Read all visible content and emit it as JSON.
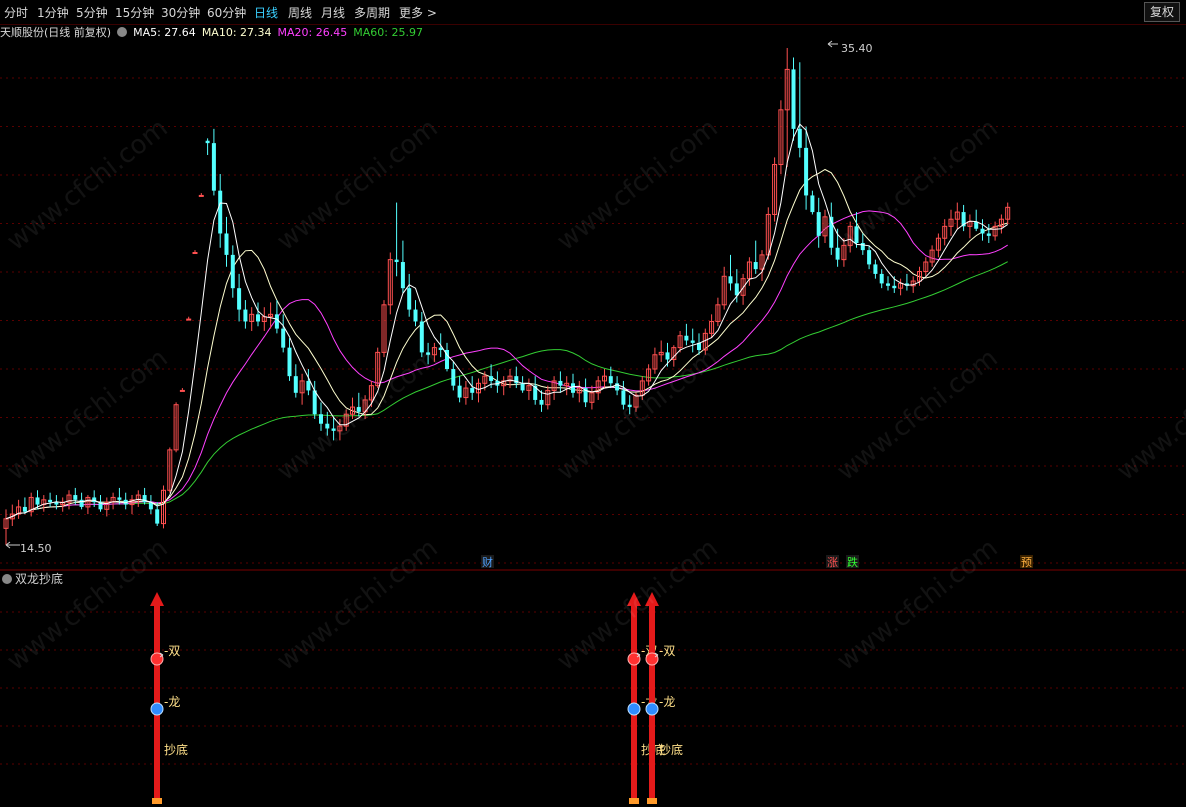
{
  "toolbar": {
    "tabs": [
      "分时",
      "1分钟",
      "5分钟",
      "15分钟",
      "30分钟",
      "60分钟",
      "日线",
      "周线",
      "月线",
      "多周期",
      "更多 >"
    ],
    "active_tab": "日线",
    "right_button": "复权"
  },
  "legend": {
    "stock": "天顺股份(日线 前复权)",
    "ma5": "MA5: 27.64",
    "ma10": "MA10: 27.34",
    "ma20": "MA20: 26.45",
    "ma60": "MA60: 25.97"
  },
  "colors": {
    "up": "#ff5050",
    "down": "#54ffff",
    "ma5": "#ffffff",
    "ma10": "#ffffd0",
    "ma20": "#ff40ff",
    "ma60": "#33cc33",
    "grid": "#5a0000",
    "signal": "#e41a1a"
  },
  "price_marks": {
    "high": "35.40",
    "low": "14.50"
  },
  "event_badges": [
    {
      "text": "财",
      "color": "#4fa0ff"
    },
    {
      "text": "涨",
      "color": "#ff5050"
    },
    {
      "text": "跌",
      "color": "#33ff33"
    },
    {
      "text": "预",
      "color": "#ffb040"
    }
  ],
  "indicator": {
    "title": "双龙抄底",
    "labels": {
      "shuang": "-双",
      "long": "-龙",
      "chaodi": "抄底"
    }
  },
  "watermark": "www.cfchi.com",
  "chart_data": {
    "type": "candlestick",
    "y_range": [
      14.5,
      35.4
    ],
    "signals_at_candle_index": [
      24,
      99,
      102
    ],
    "candles": [
      [
        15.2,
        16.0,
        14.5,
        15.6
      ],
      [
        15.6,
        16.2,
        15.3,
        15.8
      ],
      [
        15.8,
        16.4,
        15.6,
        16.1
      ],
      [
        16.1,
        16.5,
        15.8,
        15.9
      ],
      [
        15.9,
        16.7,
        15.7,
        16.5
      ],
      [
        16.5,
        16.8,
        16.0,
        16.2
      ],
      [
        16.2,
        16.6,
        15.9,
        16.4
      ],
      [
        16.4,
        16.7,
        16.1,
        16.3
      ],
      [
        16.3,
        16.6,
        16.0,
        16.2
      ],
      [
        16.2,
        16.5,
        15.9,
        16.3
      ],
      [
        16.3,
        16.8,
        16.0,
        16.6
      ],
      [
        16.6,
        16.9,
        16.2,
        16.4
      ],
      [
        16.4,
        16.7,
        16.0,
        16.1
      ],
      [
        16.1,
        16.6,
        15.8,
        16.5
      ],
      [
        16.5,
        16.8,
        16.1,
        16.3
      ],
      [
        16.3,
        16.6,
        15.9,
        16.0
      ],
      [
        16.0,
        16.5,
        15.7,
        16.3
      ],
      [
        16.3,
        16.7,
        16.0,
        16.5
      ],
      [
        16.5,
        16.9,
        16.2,
        16.4
      ],
      [
        16.4,
        16.7,
        16.0,
        16.2
      ],
      [
        16.2,
        16.6,
        15.8,
        16.4
      ],
      [
        16.4,
        16.8,
        16.1,
        16.6
      ],
      [
        16.6,
        16.9,
        16.2,
        16.3
      ],
      [
        16.3,
        16.6,
        15.8,
        16.0
      ],
      [
        16.0,
        16.3,
        15.3,
        15.4
      ],
      [
        15.4,
        17.0,
        15.2,
        16.8
      ],
      [
        16.8,
        18.6,
        16.7,
        18.5
      ],
      [
        18.5,
        20.5,
        18.4,
        20.4
      ],
      [
        21.0,
        21.1,
        21.0,
        21.0
      ],
      [
        24.0,
        24.1,
        24.0,
        24.0
      ],
      [
        26.8,
        26.9,
        26.8,
        26.8
      ],
      [
        29.2,
        29.3,
        29.2,
        29.2
      ],
      [
        31.5,
        31.6,
        30.9,
        31.4
      ],
      [
        31.4,
        32.0,
        29.2,
        29.4
      ],
      [
        29.4,
        30.1,
        27.0,
        27.6
      ],
      [
        27.6,
        28.3,
        26.2,
        26.7
      ],
      [
        26.7,
        27.1,
        24.9,
        25.3
      ],
      [
        25.3,
        25.9,
        23.9,
        24.4
      ],
      [
        24.4,
        24.8,
        23.6,
        23.9
      ],
      [
        23.9,
        24.5,
        23.5,
        24.2
      ],
      [
        24.2,
        24.7,
        23.7,
        23.9
      ],
      [
        23.9,
        24.5,
        23.5,
        24.1
      ],
      [
        24.1,
        24.7,
        23.6,
        24.2
      ],
      [
        24.2,
        24.8,
        23.4,
        23.6
      ],
      [
        23.6,
        24.2,
        22.6,
        22.8
      ],
      [
        22.8,
        23.2,
        21.4,
        21.6
      ],
      [
        21.6,
        22.1,
        20.7,
        20.9
      ],
      [
        20.9,
        21.7,
        20.4,
        21.4
      ],
      [
        21.4,
        21.9,
        20.8,
        21.0
      ],
      [
        21.0,
        21.4,
        19.8,
        20.0
      ],
      [
        20.0,
        20.5,
        19.3,
        19.6
      ],
      [
        19.6,
        20.1,
        19.1,
        19.4
      ],
      [
        19.4,
        19.9,
        18.9,
        19.3
      ],
      [
        19.3,
        19.8,
        18.9,
        19.5
      ],
      [
        19.5,
        20.2,
        19.3,
        20.0
      ],
      [
        20.0,
        20.7,
        19.8,
        20.3
      ],
      [
        20.3,
        20.9,
        19.9,
        20.1
      ],
      [
        20.1,
        20.8,
        19.8,
        20.6
      ],
      [
        20.6,
        21.4,
        20.3,
        21.2
      ],
      [
        21.2,
        22.8,
        21.1,
        22.6
      ],
      [
        22.6,
        24.8,
        22.4,
        24.6
      ],
      [
        24.6,
        26.8,
        24.2,
        26.5
      ],
      [
        26.5,
        28.9,
        25.8,
        26.4
      ],
      [
        26.4,
        27.3,
        25.1,
        25.3
      ],
      [
        25.3,
        25.9,
        24.1,
        24.4
      ],
      [
        24.4,
        24.8,
        23.7,
        23.9
      ],
      [
        23.9,
        24.3,
        22.4,
        22.6
      ],
      [
        22.6,
        23.0,
        22.1,
        22.5
      ],
      [
        22.5,
        23.0,
        22.2,
        22.8
      ],
      [
        22.8,
        23.4,
        22.4,
        22.7
      ],
      [
        22.7,
        23.0,
        21.8,
        21.9
      ],
      [
        21.9,
        22.2,
        21.0,
        21.2
      ],
      [
        21.2,
        21.6,
        20.5,
        20.7
      ],
      [
        20.7,
        21.4,
        20.4,
        21.1
      ],
      [
        21.1,
        21.6,
        20.6,
        20.9
      ],
      [
        20.9,
        21.5,
        20.5,
        21.3
      ],
      [
        21.3,
        21.8,
        21.0,
        21.6
      ],
      [
        21.6,
        22.1,
        21.1,
        21.4
      ],
      [
        21.4,
        21.8,
        20.9,
        21.2
      ],
      [
        21.2,
        21.6,
        20.8,
        21.4
      ],
      [
        21.4,
        21.9,
        21.1,
        21.6
      ],
      [
        21.6,
        22.0,
        21.1,
        21.3
      ],
      [
        21.3,
        21.6,
        20.9,
        21.0
      ],
      [
        21.0,
        21.5,
        20.6,
        21.2
      ],
      [
        21.2,
        21.6,
        20.4,
        20.6
      ],
      [
        20.6,
        21.0,
        20.1,
        20.4
      ],
      [
        20.4,
        21.2,
        20.2,
        21.0
      ],
      [
        21.0,
        21.6,
        20.6,
        21.4
      ],
      [
        21.4,
        21.8,
        20.9,
        21.2
      ],
      [
        21.2,
        21.6,
        20.8,
        21.3
      ],
      [
        21.3,
        21.7,
        20.7,
        20.9
      ],
      [
        20.9,
        21.4,
        20.5,
        21.1
      ],
      [
        21.1,
        21.5,
        20.3,
        20.5
      ],
      [
        20.5,
        21.2,
        20.2,
        20.9
      ],
      [
        20.9,
        21.6,
        20.6,
        21.4
      ],
      [
        21.4,
        21.9,
        21.1,
        21.6
      ],
      [
        21.6,
        22.0,
        21.1,
        21.3
      ],
      [
        21.3,
        21.6,
        20.8,
        21.0
      ],
      [
        21.0,
        21.4,
        20.2,
        20.4
      ],
      [
        20.4,
        20.8,
        20.0,
        20.3
      ],
      [
        20.3,
        20.9,
        20.1,
        20.8
      ],
      [
        20.8,
        21.6,
        20.6,
        21.4
      ],
      [
        21.4,
        22.1,
        21.2,
        21.9
      ],
      [
        21.9,
        22.8,
        21.7,
        22.5
      ],
      [
        22.5,
        23.1,
        22.2,
        22.6
      ],
      [
        22.6,
        23.0,
        22.0,
        22.3
      ],
      [
        22.3,
        22.9,
        22.0,
        22.8
      ],
      [
        22.8,
        23.5,
        22.6,
        23.3
      ],
      [
        23.3,
        23.8,
        22.9,
        23.1
      ],
      [
        23.1,
        23.6,
        22.6,
        23.0
      ],
      [
        23.0,
        23.4,
        22.5,
        22.7
      ],
      [
        22.7,
        23.6,
        22.5,
        23.4
      ],
      [
        23.4,
        24.2,
        23.2,
        23.9
      ],
      [
        23.9,
        24.9,
        23.7,
        24.6
      ],
      [
        24.6,
        26.2,
        24.4,
        25.8
      ],
      [
        25.8,
        26.7,
        25.2,
        25.5
      ],
      [
        25.5,
        26.1,
        24.7,
        25.0
      ],
      [
        25.0,
        25.9,
        24.6,
        25.7
      ],
      [
        25.7,
        26.6,
        25.4,
        26.4
      ],
      [
        26.4,
        27.3,
        25.9,
        26.1
      ],
      [
        26.1,
        26.9,
        25.6,
        26.7
      ],
      [
        26.7,
        28.7,
        26.5,
        28.4
      ],
      [
        28.4,
        30.8,
        28.1,
        30.5
      ],
      [
        30.5,
        33.2,
        30.1,
        32.8
      ],
      [
        32.8,
        35.4,
        30.4,
        34.5
      ],
      [
        34.5,
        35.0,
        31.5,
        32.0
      ],
      [
        32.0,
        34.8,
        30.8,
        31.2
      ],
      [
        31.2,
        32.1,
        28.6,
        29.2
      ],
      [
        29.2,
        29.4,
        28.4,
        28.5
      ],
      [
        28.5,
        29.1,
        27.0,
        27.5
      ],
      [
        27.5,
        28.6,
        27.2,
        28.3
      ],
      [
        28.3,
        28.9,
        26.7,
        27.0
      ],
      [
        27.0,
        27.8,
        26.2,
        26.5
      ],
      [
        26.5,
        27.4,
        26.2,
        27.1
      ],
      [
        27.1,
        28.1,
        26.8,
        27.9
      ],
      [
        27.9,
        28.5,
        27.0,
        27.2
      ],
      [
        27.2,
        27.6,
        26.7,
        26.9
      ],
      [
        26.9,
        27.1,
        26.1,
        26.3
      ],
      [
        26.3,
        26.5,
        25.7,
        25.9
      ],
      [
        25.9,
        26.1,
        25.3,
        25.5
      ],
      [
        25.5,
        25.8,
        25.2,
        25.4
      ],
      [
        25.4,
        25.8,
        25.1,
        25.3
      ],
      [
        25.3,
        25.7,
        25.0,
        25.5
      ],
      [
        25.5,
        25.9,
        25.2,
        25.4
      ],
      [
        25.4,
        25.8,
        25.1,
        25.6
      ],
      [
        25.6,
        26.2,
        25.4,
        26.0
      ],
      [
        26.0,
        26.6,
        25.8,
        26.4
      ],
      [
        26.4,
        27.1,
        26.2,
        26.9
      ],
      [
        26.9,
        27.6,
        26.6,
        27.4
      ],
      [
        27.4,
        28.2,
        27.1,
        27.9
      ],
      [
        27.9,
        28.6,
        27.5,
        28.2
      ],
      [
        28.2,
        28.9,
        27.8,
        28.5
      ],
      [
        28.5,
        28.8,
        27.7,
        27.9
      ],
      [
        27.9,
        28.4,
        27.4,
        28.1
      ],
      [
        28.1,
        28.6,
        27.7,
        27.8
      ],
      [
        27.8,
        28.2,
        27.3,
        27.6
      ],
      [
        27.6,
        28.0,
        27.2,
        27.5
      ],
      [
        27.5,
        28.1,
        27.3,
        27.9
      ],
      [
        27.9,
        28.4,
        27.6,
        28.2
      ],
      [
        28.2,
        28.9,
        28.0,
        28.7
      ]
    ],
    "ma": [
      {
        "name": "MA5",
        "period": 5
      },
      {
        "name": "MA10",
        "period": 10
      },
      {
        "name": "MA20",
        "period": 20
      },
      {
        "name": "MA60",
        "period": 60
      }
    ]
  }
}
